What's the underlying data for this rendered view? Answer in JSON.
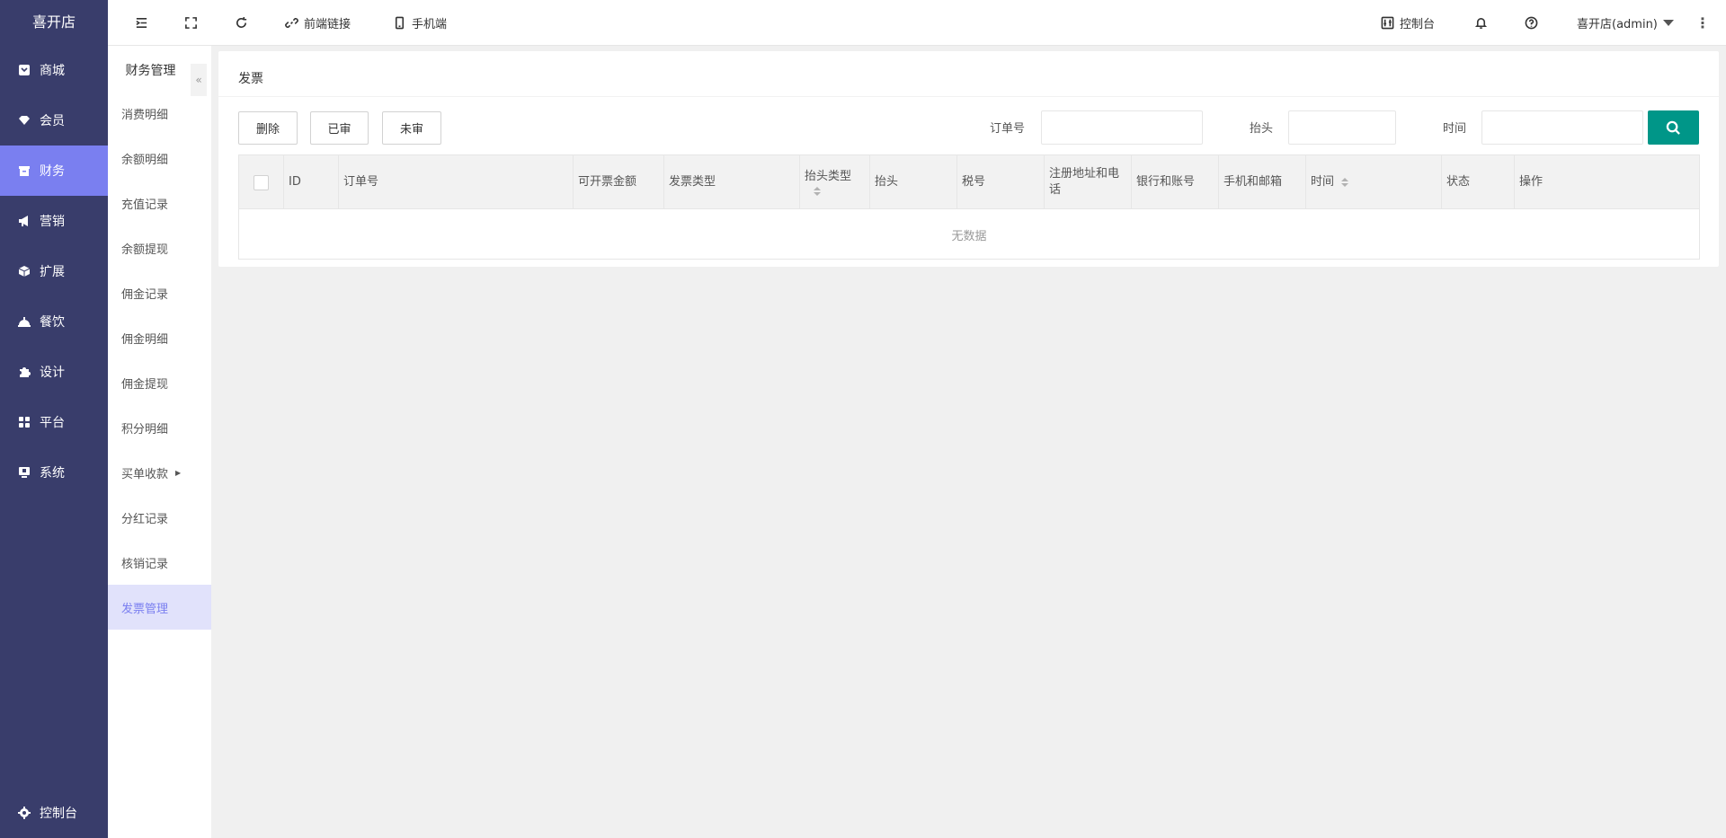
{
  "app": {
    "title": "喜开店"
  },
  "sidebar": {
    "items": [
      {
        "label": "商城",
        "icon": "shop-icon"
      },
      {
        "label": "会员",
        "icon": "member-icon"
      },
      {
        "label": "财务",
        "icon": "finance-icon",
        "active": true
      },
      {
        "label": "营销",
        "icon": "megaphone-icon"
      },
      {
        "label": "扩展",
        "icon": "cube-icon"
      },
      {
        "label": "餐饮",
        "icon": "dining-icon"
      },
      {
        "label": "设计",
        "icon": "puzzle-icon"
      },
      {
        "label": "平台",
        "icon": "grid-icon"
      },
      {
        "label": "系统",
        "icon": "monitor-icon"
      }
    ],
    "footer": {
      "label": "控制台",
      "icon": "gear-icon"
    }
  },
  "subnav": {
    "title": "财务管理",
    "collapse_glyph": "«",
    "items": [
      {
        "label": "消费明细"
      },
      {
        "label": "余额明细"
      },
      {
        "label": "充值记录"
      },
      {
        "label": "余额提现"
      },
      {
        "label": "佣金记录"
      },
      {
        "label": "佣金明细"
      },
      {
        "label": "佣金提现"
      },
      {
        "label": "积分明细"
      },
      {
        "label": "买单收款",
        "has_children": true
      },
      {
        "label": "分红记录"
      },
      {
        "label": "核销记录"
      },
      {
        "label": "发票管理",
        "active": true
      }
    ]
  },
  "header": {
    "frontend_link": "前端链接",
    "mobile": "手机端",
    "console": "控制台",
    "user": "喜开店(admin)"
  },
  "page": {
    "title": "发票",
    "buttons": {
      "delete": "删除",
      "approved": "已审",
      "unapproved": "未审"
    },
    "filters": {
      "order_no_label": "订单号",
      "title_label": "抬头",
      "time_label": "时间"
    }
  },
  "table": {
    "columns": [
      "ID",
      "订单号",
      "可开票金额",
      "发票类型",
      "抬头类型",
      "抬头",
      "税号",
      "注册地址和电话",
      "银行和账号",
      "手机和邮箱",
      "时间",
      "状态",
      "操作"
    ],
    "empty_text": "无数据"
  },
  "colors": {
    "sidebar": "#393d6b",
    "active": "#7a7ff0",
    "search_button": "#009688"
  }
}
